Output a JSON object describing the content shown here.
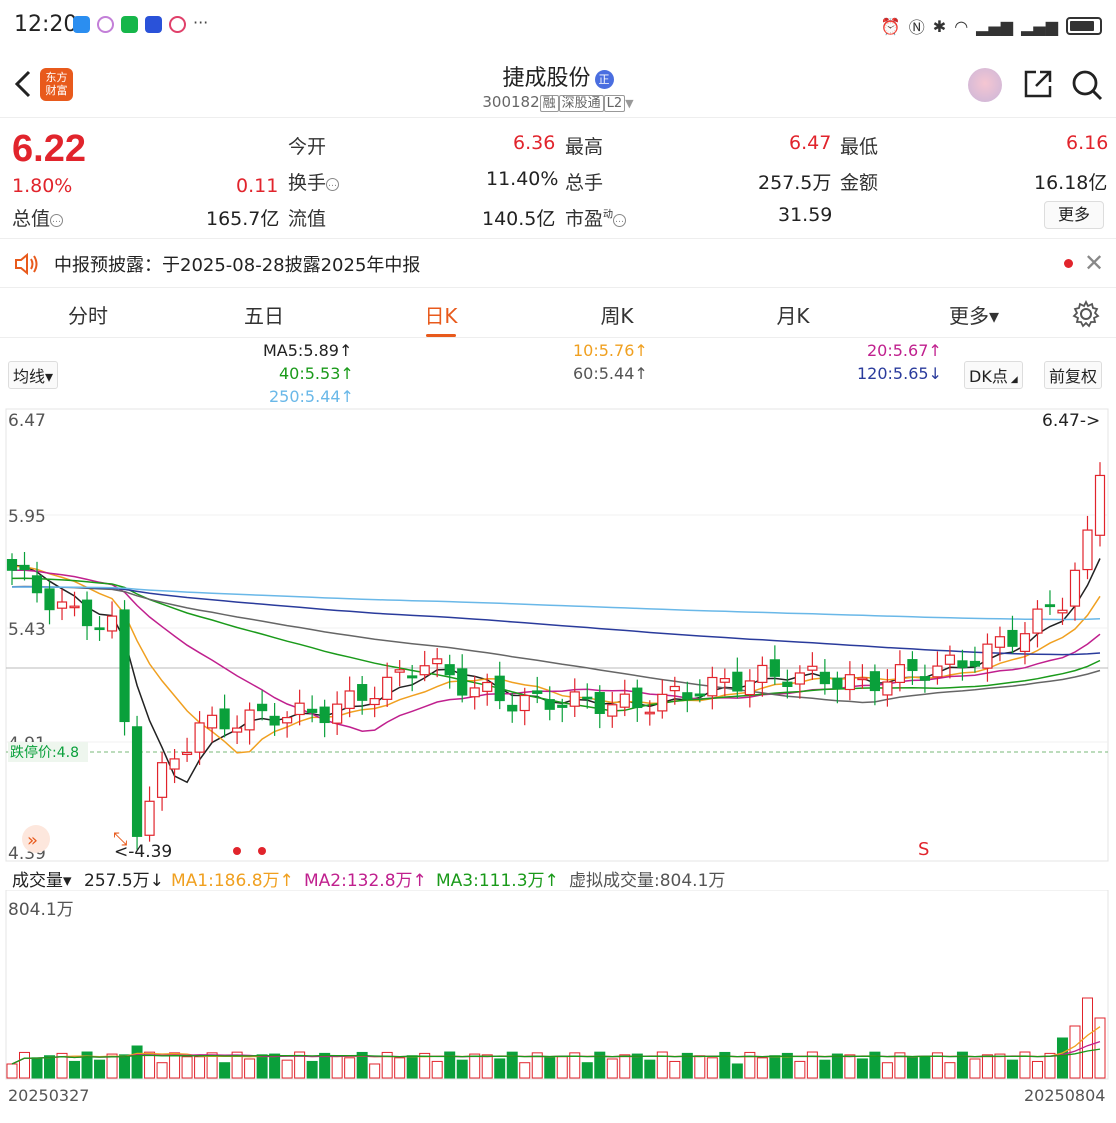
{
  "status_bar": {
    "time": "12:20"
  },
  "header": {
    "stock_name": "捷成股份",
    "badge": "正",
    "code": "300182",
    "tag_rong": "融",
    "tag_sgt": "深股通",
    "tag_l2": "L2",
    "logo_text_1": "东方",
    "logo_text_2": "财富"
  },
  "quote": {
    "price": "6.22",
    "change_pct": "1.80%",
    "change_amt": "0.11",
    "open_label": "今开",
    "open": "6.36",
    "high_label": "最高",
    "high": "6.47",
    "low_label": "最低",
    "low": "6.16",
    "turnover_label": "换手",
    "turnover": "11.40%",
    "volume_label": "总手",
    "volume": "257.5万",
    "amount_label": "金额",
    "amount": "16.18亿",
    "mcap_label": "总值",
    "mcap": "165.7亿",
    "float_label": "流值",
    "float": "140.5亿",
    "pe_label": "市盈",
    "pe_sup": "动",
    "pe": "31.59",
    "more_label": "更多"
  },
  "notice": {
    "text": "中报预披露：于2025-08-28披露2025年中报"
  },
  "tabs": [
    {
      "label": "分时"
    },
    {
      "label": "五日"
    },
    {
      "label": "日K"
    },
    {
      "label": "周K"
    },
    {
      "label": "月K"
    },
    {
      "label": "更多▾"
    }
  ],
  "ma_legend": {
    "selector": "均线▾",
    "ma5": "MA5:5.89↑",
    "ma10": "10:5.76↑",
    "ma20": "20:5.67↑",
    "ma40": "40:5.53↑",
    "ma60": "60:5.44↑",
    "ma120": "120:5.65↓",
    "ma250": "250:5.44↑",
    "dk_btn": "DK点",
    "fq_btn": "前复权"
  },
  "kchart": {
    "y_labels": [
      "6.47",
      "5.95",
      "5.43",
      "4.91",
      "4.39"
    ],
    "limit_down_label": "跌停价:4.8",
    "max_marker": "6.47->",
    "min_marker": "<-4.39",
    "signal": "S"
  },
  "volume_legend": {
    "selector": "成交量▾",
    "vol": "257.5万↓",
    "ma1": "MA1:186.8万↑",
    "ma2": "MA2:132.8万↑",
    "ma3": "MA3:111.3万↑",
    "virtual": "虚拟成交量:804.1万",
    "max_label": "804.1万"
  },
  "dates": {
    "start": "20250327",
    "end": "20250804"
  },
  "colors": {
    "up": "#e1242c",
    "down": "#0aa03b",
    "accent": "#e85a1c",
    "ma5": "#222222",
    "ma10": "#f0a020",
    "ma20": "#c0208e",
    "ma40": "#1a9a1a",
    "ma60": "#666666",
    "ma120": "#2a3b9c",
    "ma250": "#6ab8e8"
  }
}
